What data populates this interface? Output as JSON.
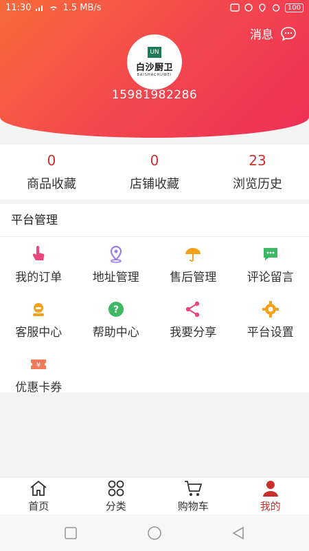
{
  "status_bar": {
    "time": "11:30",
    "network_speed": "1.5 MB/s",
    "battery": "100"
  },
  "header": {
    "message_label": "消息",
    "logo_brand": "白沙厨卫",
    "logo_pinyin": "BAISHACHUWEI",
    "logo_mark": "UN",
    "phone": "15981982286"
  },
  "stats": [
    {
      "value": "0",
      "label": "商品收藏"
    },
    {
      "value": "0",
      "label": "店铺收藏"
    },
    {
      "value": "23",
      "label": "浏览历史"
    }
  ],
  "panel": {
    "title": "平台管理",
    "items": [
      {
        "label": "我的订单",
        "icon": "hand-pointer-icon",
        "color": "#e9467c"
      },
      {
        "label": "地址管理",
        "icon": "location-pin-icon",
        "color": "#9b7de8"
      },
      {
        "label": "售后管理",
        "icon": "umbrella-icon",
        "color": "#f4a11a"
      },
      {
        "label": "评论留言",
        "icon": "chat-bubble-icon",
        "color": "#3fb865"
      },
      {
        "label": "客服中心",
        "icon": "headset-icon",
        "color": "#f4a11a"
      },
      {
        "label": "帮助中心",
        "icon": "question-icon",
        "color": "#3fb865"
      },
      {
        "label": "我要分享",
        "icon": "share-icon",
        "color": "#e9467c"
      },
      {
        "label": "平台设置",
        "icon": "gear-icon",
        "color": "#f4a11a"
      },
      {
        "label": "优惠卡券",
        "icon": "coupon-icon",
        "color": "#f07a5a"
      }
    ]
  },
  "tabbar": [
    {
      "label": "首页",
      "icon": "home-icon",
      "active": false
    },
    {
      "label": "分类",
      "icon": "category-icon",
      "active": false
    },
    {
      "label": "购物车",
      "icon": "cart-icon",
      "active": false
    },
    {
      "label": "我的",
      "icon": "user-icon",
      "active": true
    }
  ],
  "colors": {
    "accent": "#c9302c",
    "hero_start": "#f86a3a",
    "hero_end": "#ee2f58"
  }
}
